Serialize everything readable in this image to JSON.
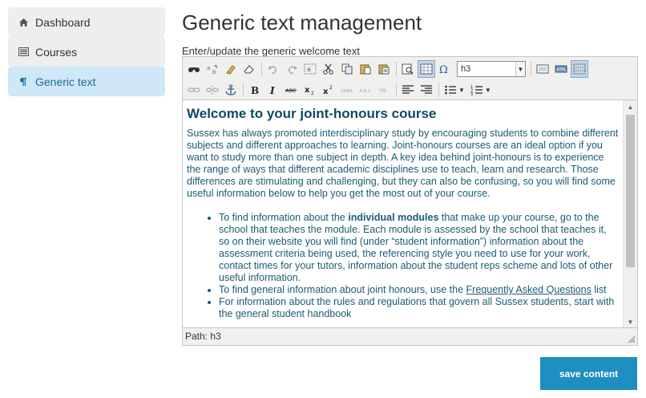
{
  "sidebar": {
    "items": [
      {
        "label": "Dashboard",
        "icon": "home-icon"
      },
      {
        "label": "Courses",
        "icon": "list-icon"
      },
      {
        "label": "Generic text",
        "icon": "pilcrow-icon",
        "active": true
      }
    ]
  },
  "main": {
    "title": "Generic text management",
    "field_label": "Enter/update the generic welcome text"
  },
  "editor": {
    "format_select": "h3",
    "status_path": "Path: h3",
    "heading": "Welcome to your joint-honours course",
    "paragraph": "Sussex has always promoted interdisciplinary study by encouraging students to combine different subjects and different approaches to learning. Joint-honours courses are an ideal option if you want to study more than one subject in depth. A key idea behind joint-honours is to experience the range of ways that different academic disciplines use to teach, learn and research. Those differences are stimulating and challenging, but they can also be confusing, so you will find some useful information below to help you get the most out of your course.",
    "bullets": {
      "b1_pre": "To find information about the ",
      "b1_bold": "individual modules",
      "b1_post": " that make up your course, go to the school that teaches the module. Each module is assessed by the school that teaches it, so on their website you will find (under “student information”) information about the assessment criteria being used, the referencing style you need to use for your work, contact times for your tutors, information about the student reps scheme and lots of other useful information.",
      "b2_pre": "To find general information about joint honours, use the ",
      "b2_link": "Frequently Asked Questions",
      "b2_post": " list",
      "b3": "For information about the rules and regulations that govern all Sussex students, start with the general student handbook"
    }
  },
  "actions": {
    "save_label": "save content"
  },
  "colors": {
    "accent": "#1e8fc0",
    "active_nav_bg": "#cfe8f8",
    "active_nav_text": "#1e6a99",
    "content_text": "#1a5b77"
  }
}
